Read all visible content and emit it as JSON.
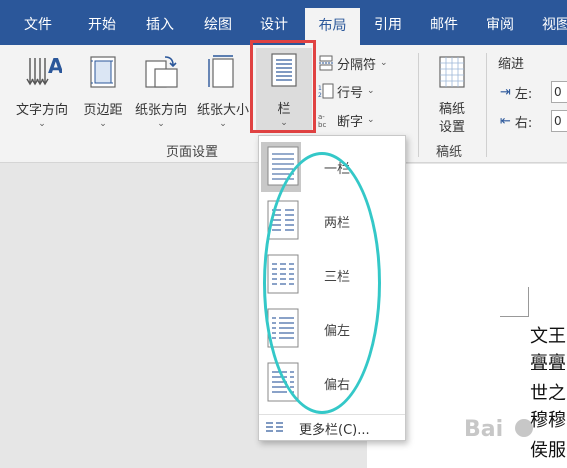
{
  "tabs": [
    "文件",
    "开始",
    "插入",
    "绘图",
    "设计",
    "布局",
    "引用",
    "邮件",
    "审阅",
    "视图"
  ],
  "active_tab": "布局",
  "ribbon": {
    "text_direction": "文字方向",
    "margins": "页边距",
    "orientation": "纸张方向",
    "size": "纸张大小",
    "columns": "栏",
    "breaks": "分隔符",
    "line_numbers": "行号",
    "hyphenation": "断字",
    "page_setup_group": "页面设置",
    "manuscript": "稿纸\n设置",
    "manuscript_1": "稿纸",
    "manuscript_2": "设置",
    "manuscript_group": "稿纸",
    "indent": "缩进",
    "left": "左:",
    "right": "右:",
    "left_value": "0",
    "right_value": "0"
  },
  "dropdown": {
    "items": [
      {
        "label": "一栏",
        "cols": 1
      },
      {
        "label": "两栏",
        "cols": 2
      },
      {
        "label": "三栏",
        "cols": 3
      },
      {
        "label": "偏左",
        "cols": 4
      },
      {
        "label": "偏右",
        "cols": 5
      }
    ],
    "selected": "一栏",
    "more": "更多栏(C)..."
  },
  "document": {
    "lines": [
      "文王",
      "亹亹",
      "世之",
      "穆穆",
      "侯服"
    ]
  },
  "colors": {
    "tabbar": "#2b579a",
    "highlight_box": "#e04242",
    "annotation_ellipse": "#34c8c8"
  }
}
